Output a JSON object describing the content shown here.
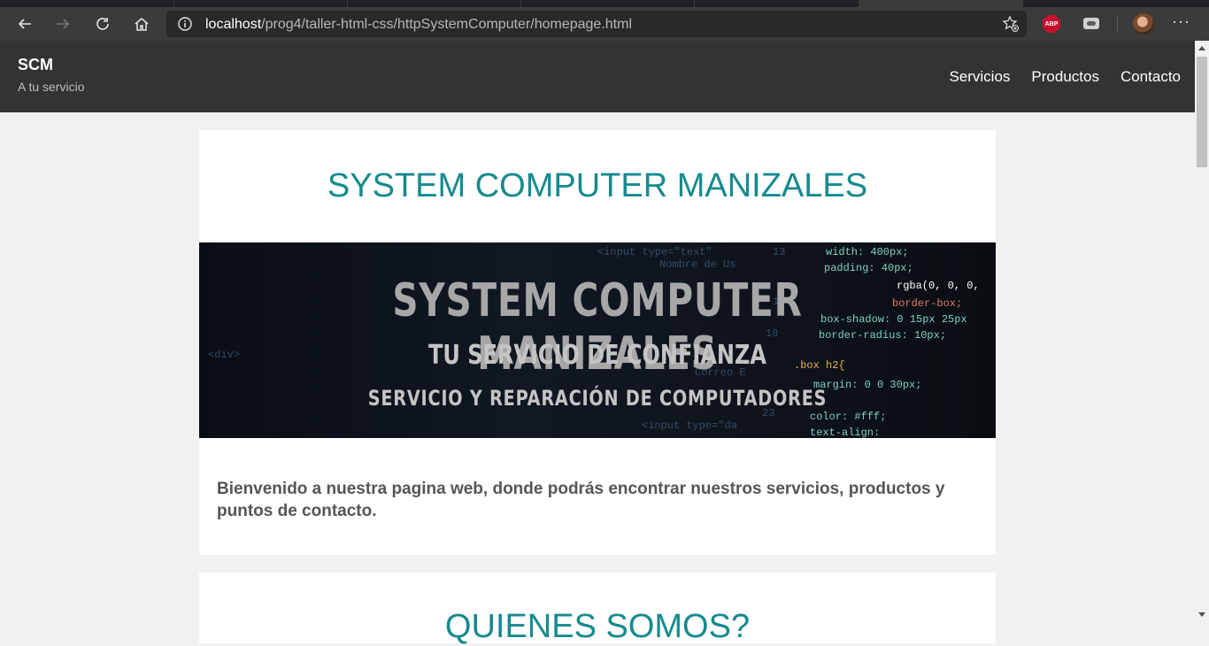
{
  "browser": {
    "url_host": "localhost",
    "url_path": "/prog4/taller-html-css/httpSystemComputer/homepage.html",
    "extension_abp_label": "ABP"
  },
  "site": {
    "brand": "SCM",
    "tagline": "A tu servicio",
    "nav": [
      "Servicios",
      "Productos",
      "Contacto"
    ]
  },
  "main": {
    "title": "SYSTEM COMPUTER MANIZALES",
    "banner": {
      "line1": "SYSTEM COMPUTER MANIZALES",
      "line2": "TU SERVICIO DE CONFIANZA",
      "line3": "SERVICIO Y REPARACIÓN DE COMPUTADORES"
    },
    "welcome": "Bienvenido a nuestra pagina web, donde podrás encontrar nuestros servicios, productos y puntos de contacto.",
    "section2_title": "QUIENES SOMOS?"
  },
  "colors": {
    "header_bg": "#333333",
    "accent_teal": "#168a8e",
    "page_bg": "#f1f1f1"
  }
}
